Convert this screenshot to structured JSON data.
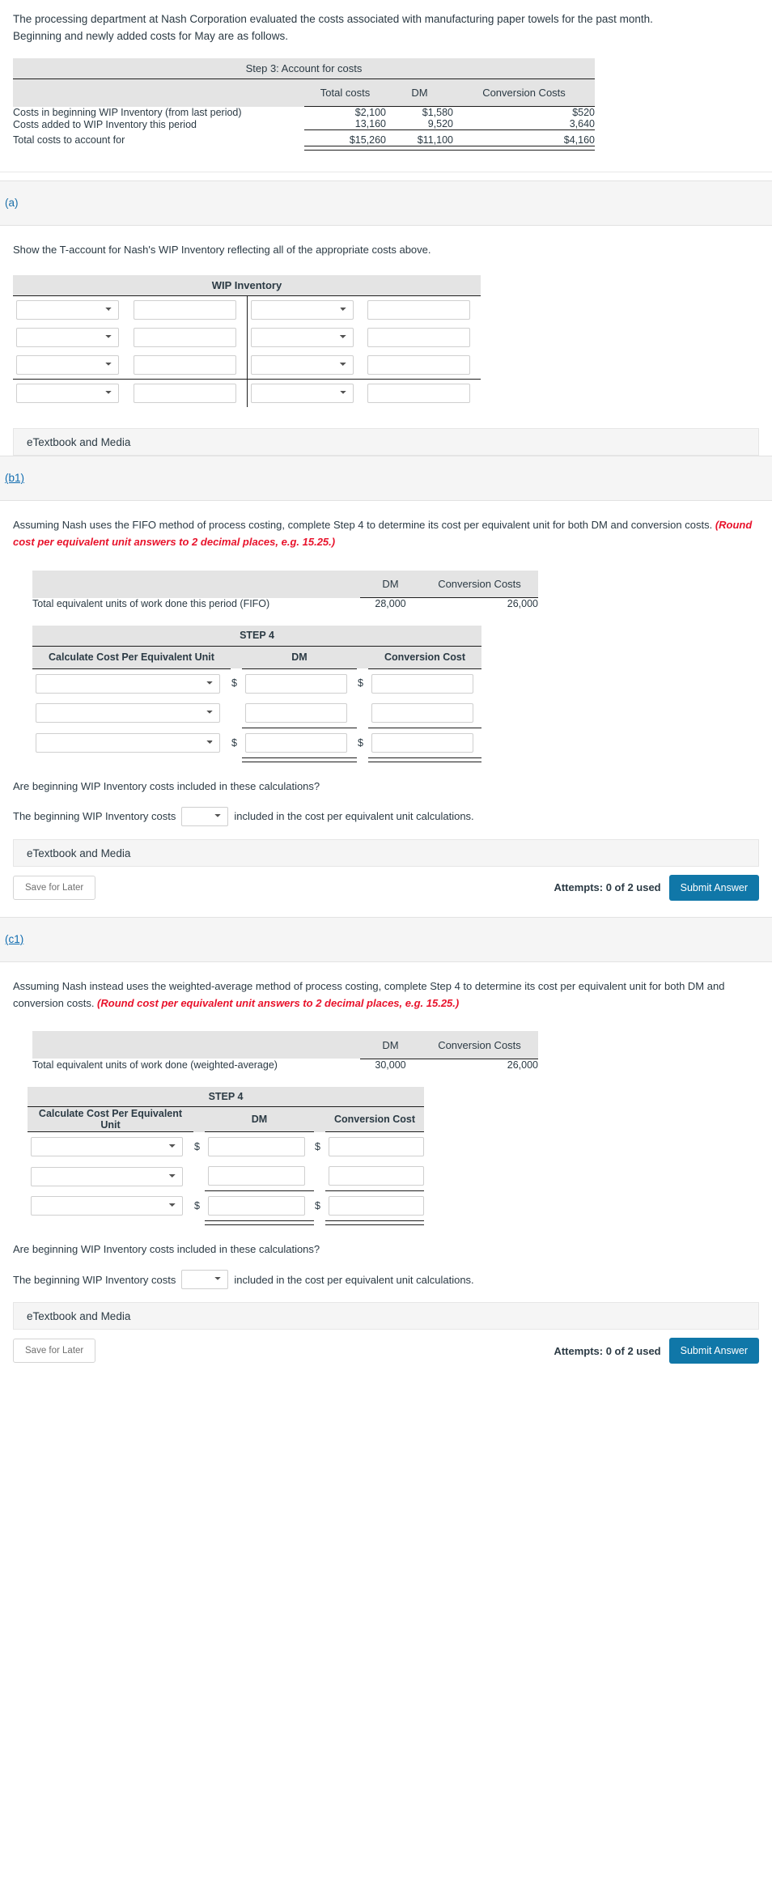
{
  "intro": {
    "line1": "The processing department at Nash Corporation evaluated the costs associated with manufacturing paper towels for the past month.",
    "line2": "Beginning and newly added costs for May are as follows."
  },
  "step3_table": {
    "title": "Step 3: Account for costs",
    "columns": [
      "",
      "Total costs",
      "DM",
      "Conversion Costs"
    ],
    "rows": [
      {
        "label": "Costs in beginning WIP Inventory (from last period)",
        "total": "$2,100",
        "dm": "$1,580",
        "cc": "$520"
      },
      {
        "label": "Costs added to WIP Inventory this period",
        "total": "13,160",
        "dm": "9,520",
        "cc": "3,640"
      },
      {
        "label": "Total costs to account for",
        "total": "$15,260",
        "dm": "$11,100",
        "cc": "$4,160"
      }
    ]
  },
  "section_a": {
    "key": "(a)",
    "prompt": "Show the T-account for Nash's WIP Inventory reflecting all of the appropriate costs above.",
    "taccount_title": "WIP Inventory",
    "rows_above": 3,
    "rows_below": 1,
    "select_value": "",
    "input_value": "",
    "etextbook_label": "eTextbook and Media"
  },
  "section_b1": {
    "key": "(b1)",
    "prompt_part1": "Assuming Nash uses the FIFO method of process costing, complete Step 4 to determine its cost per equivalent unit for both DM and conversion costs. ",
    "prompt_warn": "(Round cost per equivalent unit answers to 2 decimal places, e.g. 15.25.)",
    "eu_table": {
      "columns": [
        "",
        "DM",
        "Conversion Costs"
      ],
      "row_label": "Total equivalent units of work done this period (FIFO)",
      "dm": "28,000",
      "cc": "26,000"
    },
    "step4": {
      "title": "STEP 4",
      "columns": [
        "Calculate Cost Per Equivalent Unit",
        "DM",
        "Conversion Cost"
      ],
      "dollar": "$",
      "rows": [
        {
          "select": "",
          "dm": "",
          "cc": "",
          "show_dollar": true
        },
        {
          "select": "",
          "dm": "",
          "cc": "",
          "show_dollar": false
        },
        {
          "select": "",
          "dm": "",
          "cc": "",
          "show_dollar": true
        }
      ]
    },
    "question": "Are beginning WIP Inventory costs included in these calculations?",
    "answer_prefix": "The beginning WIP Inventory costs",
    "answer_select_value": "",
    "answer_suffix": "included in the cost per equivalent unit calculations.",
    "etextbook_label": "eTextbook and Media",
    "save_label": "Save for Later",
    "attempts_label": "Attempts: 0 of 2 used",
    "submit_label": "Submit Answer"
  },
  "section_c1": {
    "key": "(c1)",
    "prompt_part1": "Assuming Nash instead uses the weighted-average method of process costing, complete Step 4 to determine its cost per equivalent unit for both DM and conversion costs. ",
    "prompt_warn": "(Round cost per equivalent unit answers to 2 decimal places, e.g. 15.25.)",
    "eu_table": {
      "columns": [
        "",
        "DM",
        "Conversion Costs"
      ],
      "row_label": "Total equivalent units of work done (weighted-average)",
      "dm": "30,000",
      "cc": "26,000"
    },
    "step4": {
      "title": "STEP 4",
      "columns": [
        "Calculate Cost Per Equivalent Unit",
        "DM",
        "Conversion Cost"
      ],
      "dollar": "$",
      "rows": [
        {
          "select": "",
          "dm": "",
          "cc": "",
          "show_dollar": true
        },
        {
          "select": "",
          "dm": "",
          "cc": "",
          "show_dollar": false
        },
        {
          "select": "",
          "dm": "",
          "cc": "",
          "show_dollar": true
        }
      ]
    },
    "question": "Are beginning WIP Inventory costs included in these calculations?",
    "answer_prefix": "The beginning WIP Inventory costs",
    "answer_select_value": "",
    "answer_suffix": "included in the cost per equivalent unit calculations.",
    "etextbook_label": "eTextbook and Media",
    "save_label": "Save for Later",
    "attempts_label": "Attempts: 0 of 2 used",
    "submit_label": "Submit Answer"
  },
  "colors": {
    "submit_bg": "#1077a8",
    "link": "#0f6cb0",
    "warn": "#e8122b",
    "shade": "#e4e4e4",
    "band": "#f5f5f5"
  }
}
